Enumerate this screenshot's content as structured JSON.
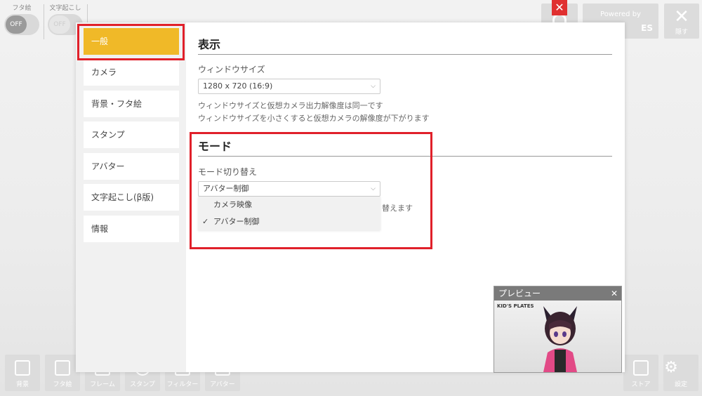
{
  "toggles": [
    {
      "label": "フタ絵",
      "state": "OFF"
    },
    {
      "label": "文字起こし",
      "state": "OFF"
    }
  ],
  "top_right": {
    "powered_text": "Powered by",
    "powered_logo": "ES",
    "hide_label": "隠す",
    "hide_icon": "✕"
  },
  "bottom_toolbar": {
    "left": [
      {
        "label": "背景",
        "icon": "background-icon"
      },
      {
        "label": "フタ絵",
        "icon": "cover-icon"
      },
      {
        "label": "フレーム",
        "icon": "frame-icon"
      },
      {
        "label": "スタンプ",
        "icon": "stamp-icon"
      },
      {
        "label": "フィルター",
        "icon": "filter-icon"
      },
      {
        "label": "アバター",
        "icon": "avatar-icon"
      }
    ],
    "right": [
      {
        "label": "ストア",
        "icon": "store-icon"
      },
      {
        "label": "設定",
        "icon": "gear-icon"
      }
    ]
  },
  "settings": {
    "sidebar": [
      {
        "label": "一般",
        "active": true
      },
      {
        "label": "カメラ",
        "active": false
      },
      {
        "label": "背景・フタ絵",
        "active": false
      },
      {
        "label": "スタンプ",
        "active": false
      },
      {
        "label": "アバター",
        "active": false
      },
      {
        "label": "文字起こし(β版)",
        "active": false
      },
      {
        "label": "情報",
        "active": false
      }
    ],
    "close_icon": "✕",
    "display": {
      "title": "表示",
      "window_size_label": "ウィンドウサイズ",
      "window_size_value": "1280 x 720 (16:9)",
      "help_line1": "ウィンドウサイズと仮想カメラ出力解像度は同一です",
      "help_line2": "ウィンドウサイズを小さくすると仮想カメラの解像度が下がります"
    },
    "mode": {
      "title": "モード",
      "switch_label": "モード切り替え",
      "current_value": "アバター制御",
      "options": [
        {
          "label": "カメラ映像",
          "selected": false
        },
        {
          "label": "アバター制御",
          "selected": true
        }
      ],
      "help_partial": "替えます"
    }
  },
  "preview": {
    "title": "プレビュー",
    "close_icon": "✕",
    "logo": "KID'S PLATES"
  },
  "colors": {
    "accent": "#f0b928",
    "highlight_red": "#e0202a",
    "close_red": "#e03030"
  }
}
